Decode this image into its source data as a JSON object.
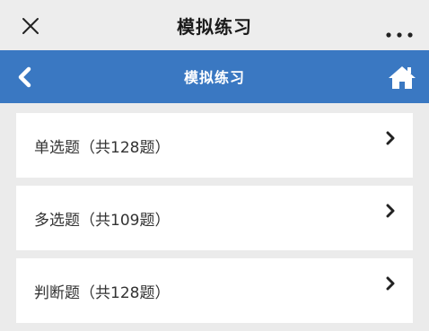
{
  "wechat_bar": {
    "title": "模拟练习",
    "close_icon": "close-icon",
    "more_icon": "more-icon"
  },
  "header": {
    "title": "模拟练习",
    "back_icon": "back-chevron-icon",
    "home_icon": "home-icon",
    "bg_color": "#3a78c2"
  },
  "items": [
    {
      "label": "单选题（共128题）"
    },
    {
      "label": "多选题（共109题）"
    },
    {
      "label": "判断题（共128题）"
    }
  ]
}
